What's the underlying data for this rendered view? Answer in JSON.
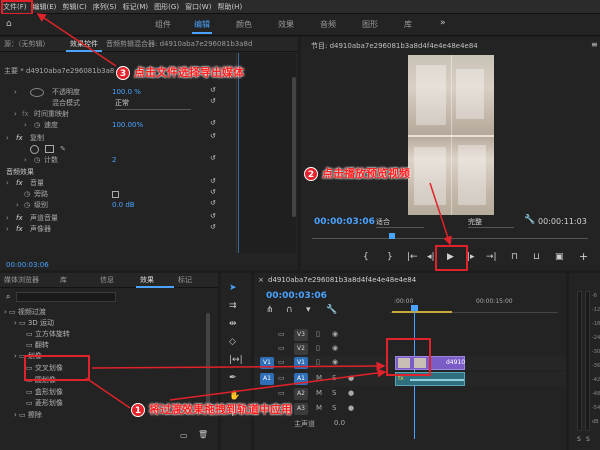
{
  "menu": [
    "文件(F)",
    "编辑(E)",
    "剪辑(C)",
    "序列(S)",
    "标记(M)",
    "图形(G)",
    "窗口(W)",
    "帮助(H)"
  ],
  "workspaces": [
    "组件",
    "编辑",
    "颜色",
    "效果",
    "音频",
    "图形",
    "库"
  ],
  "active_workspace": "编辑",
  "left_panel": {
    "tabs": [
      "源：（无剪辑）",
      "效果控件",
      "音频剪辑混合器: d4910aba7e296081b3a8d4f4e4e"
    ],
    "clip_header": "主要 * d4910aba7e296081b3a8d...",
    "rows": [
      {
        "label": "不透明度",
        "value": "100.0 %"
      },
      {
        "label": "混合模式",
        "value": "正常"
      },
      {
        "label": "时间重映射",
        "value": ""
      },
      {
        "label": "速度",
        "value": "100.00%"
      },
      {
        "label": "复制",
        "value": ""
      },
      {
        "label": "计数",
        "value": "2"
      },
      {
        "label": "音频效果",
        "value": ""
      },
      {
        "label": "音量",
        "value": ""
      },
      {
        "label": "旁路",
        "value": ""
      },
      {
        "label": "级别",
        "value": "0.0 dB"
      },
      {
        "label": "声道音量",
        "value": ""
      },
      {
        "label": "声像器",
        "value": ""
      }
    ],
    "timecode": "00:00:03:06"
  },
  "program": {
    "title": "节目: d4910aba7e296081b3a8d4f4e4e48e4e84",
    "timecode": "00:00:03:06",
    "fit": "适合",
    "quality": "完整",
    "duration": "00:00:11:03"
  },
  "effects_panel": {
    "tabs": [
      "媒体浏览器",
      "库",
      "信息",
      "效果",
      "标记"
    ],
    "items": [
      "视频过渡",
      "3D 运动",
      "立方体旋转",
      "翻转",
      "划像",
      "交叉划像",
      "圆划像",
      "盒形划像",
      "菱形划像",
      "擦除"
    ]
  },
  "timeline": {
    "title": "d4910aba7e296081b3a8d4f4e4e48e4e84",
    "timecode": "00:00:03:06",
    "ruler": [
      ":00:00",
      "00:00:15:00"
    ],
    "tracks": [
      "V3",
      "V2",
      "V1",
      "A1",
      "A2",
      "A3"
    ],
    "src_v": "V1",
    "src_a": "A1",
    "track_extra": "主声道",
    "track_extra_value": "0.0",
    "clip_label": "d4910",
    "clip_fx_badge": "fx"
  },
  "meter": {
    "scale": [
      "-6",
      "-12",
      "-18",
      "-24",
      "-30",
      "-36",
      "-42",
      "-48",
      "-54",
      "dB"
    ],
    "solo": [
      "S",
      "S"
    ]
  },
  "annotations": {
    "a1": "将过渡效果拖拽到轨道中应用",
    "a2": "点击播放预览视频",
    "a3": "点击文件选择导出媒体",
    "n1": "1",
    "n2": "2",
    "n3": "3"
  },
  "colors": {
    "accent": "#4aa3ff",
    "annotation": "#e0222a"
  }
}
